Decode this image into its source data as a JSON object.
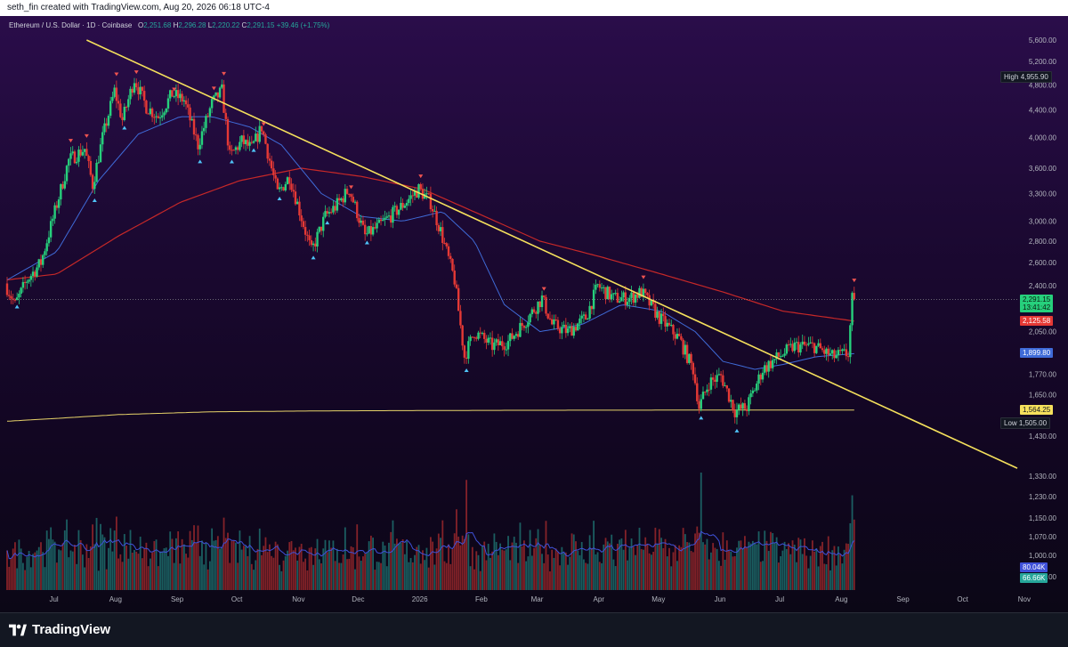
{
  "header": {
    "credit": "seth_fin created with TradingView.com, Aug 20, 2026 06:18 UTC-4"
  },
  "legend": {
    "symbol": "Ethereum / U.S. Dollar · 1D · Coinbase",
    "open_label": "O",
    "open": "2,251.68",
    "high_label": "H",
    "high": "2,296.28",
    "low_label": "L",
    "low": "2,220.22",
    "close_label": "C",
    "close": "2,291.15",
    "change": "+39.46 (+1.75%)"
  },
  "price_tags": {
    "high_label": "High",
    "high_value": "4,955.90",
    "last_value": "2,291.15",
    "countdown": "13:41:42",
    "ma_red": "2,125.58",
    "ma_blue": "1,899.80",
    "ma_yellow": "1,564.25",
    "low_label": "Low",
    "low_value": "1,505.00",
    "vol_blue": "80.04K",
    "vol_green": "66.66K"
  },
  "footer": {
    "brand": "TradingView"
  },
  "colors": {
    "up": "#26d07c",
    "down": "#e53935",
    "ma_blue": "#3f6bd8",
    "ma_red": "#c62828",
    "ma_yellow": "#e8d36a",
    "trendline": "#f5e05c",
    "marker_up": "#4fc3f7",
    "marker_down": "#ef5350"
  },
  "chart_data": {
    "type": "candlestick",
    "price_scale": "log",
    "y_tick_labels": [
      "5,600.00",
      "5,200.00",
      "4,800.00",
      "4,400.00",
      "4,000.00",
      "3,600.00",
      "3,300.00",
      "3,000.00",
      "2,800.00",
      "2,600.00",
      "2,400.00",
      "2,050.00",
      "1,770.00",
      "1,650.00",
      "1,430.00",
      "1,330.00",
      "1,230.00",
      "1,150.00",
      "1,070.00",
      "1,000.00",
      "920.00"
    ],
    "y_ticks": [
      5600,
      5200,
      4800,
      4400,
      4000,
      3600,
      3300,
      3000,
      2800,
      2600,
      2400,
      2050,
      1770,
      1650,
      1430,
      1330,
      1230,
      1150,
      1070,
      1000,
      920
    ],
    "x_labels": [
      "Jul",
      "Aug",
      "Sep",
      "Oct",
      "Nov",
      "Dec",
      "2026",
      "Feb",
      "Mar",
      "Apr",
      "May",
      "Jun",
      "Jul",
      "Aug",
      "Sep",
      "Oct",
      "Nov"
    ],
    "x_label_dates": [
      "2025-07-01",
      "2025-08-01",
      "2025-09-01",
      "2025-10-01",
      "2025-11-01",
      "2025-12-01",
      "2026-01-01",
      "2026-02-01",
      "2026-03-01",
      "2026-04-01",
      "2026-05-01",
      "2026-06-01",
      "2026-07-01",
      "2026-08-01",
      "2026-09-01",
      "2026-10-01",
      "2026-11-01"
    ],
    "price_path": [
      [
        "2025-06-20",
        2420
      ],
      [
        "2025-06-25",
        2250
      ],
      [
        "2025-07-01",
        2450
      ],
      [
        "2025-07-08",
        2600
      ],
      [
        "2025-07-15",
        3100
      ],
      [
        "2025-07-22",
        3700
      ],
      [
        "2025-07-30",
        3850
      ],
      [
        "2025-08-03",
        3400
      ],
      [
        "2025-08-08",
        4000
      ],
      [
        "2025-08-14",
        4700
      ],
      [
        "2025-08-18",
        4250
      ],
      [
        "2025-08-24",
        4900
      ],
      [
        "2025-08-30",
        4450
      ],
      [
        "2025-09-05",
        4300
      ],
      [
        "2025-09-12",
        4650
      ],
      [
        "2025-09-18",
        4550
      ],
      [
        "2025-09-25",
        3900
      ],
      [
        "2025-10-02",
        4500
      ],
      [
        "2025-10-07",
        4700
      ],
      [
        "2025-10-11",
        3750
      ],
      [
        "2025-10-17",
        3950
      ],
      [
        "2025-10-22",
        3850
      ],
      [
        "2025-10-27",
        4150
      ],
      [
        "2025-11-04",
        3300
      ],
      [
        "2025-11-10",
        3500
      ],
      [
        "2025-11-21",
        2700
      ],
      [
        "2025-11-28",
        3050
      ],
      [
        "2025-12-03",
        3150
      ],
      [
        "2025-12-10",
        3350
      ],
      [
        "2025-12-18",
        2850
      ],
      [
        "2025-12-25",
        2950
      ],
      [
        "2026-01-05",
        3150
      ],
      [
        "2026-01-14",
        3350
      ],
      [
        "2026-01-20",
        3200
      ],
      [
        "2026-01-25",
        2900
      ],
      [
        "2026-02-01",
        2450
      ],
      [
        "2026-02-06",
        1880
      ],
      [
        "2026-02-11",
        2050
      ],
      [
        "2026-02-20",
        1950
      ],
      [
        "2026-02-28",
        1980
      ],
      [
        "2026-03-10",
        2150
      ],
      [
        "2026-03-17",
        2300
      ],
      [
        "2026-03-22",
        2100
      ],
      [
        "2026-03-30",
        2050
      ],
      [
        "2026-04-08",
        2150
      ],
      [
        "2026-04-14",
        2400
      ],
      [
        "2026-04-22",
        2300
      ],
      [
        "2026-04-30",
        2300
      ],
      [
        "2026-05-06",
        2350
      ],
      [
        "2026-05-15",
        2150
      ],
      [
        "2026-05-25",
        2000
      ],
      [
        "2026-06-01",
        1800
      ],
      [
        "2026-06-04",
        1580
      ],
      [
        "2026-06-09",
        1720
      ],
      [
        "2026-06-15",
        1760
      ],
      [
        "2026-06-22",
        1560
      ],
      [
        "2026-06-28",
        1580
      ],
      [
        "2026-07-06",
        1800
      ],
      [
        "2026-07-14",
        1880
      ],
      [
        "2026-07-22",
        1950
      ],
      [
        "2026-08-01",
        1950
      ],
      [
        "2026-08-10",
        1880
      ],
      [
        "2026-08-18",
        1900
      ],
      [
        "2026-08-20",
        2290
      ]
    ],
    "ma_blue_path": [
      [
        "2025-06-20",
        2450
      ],
      [
        "2025-07-15",
        2700
      ],
      [
        "2025-08-05",
        3450
      ],
      [
        "2025-08-25",
        4050
      ],
      [
        "2025-09-15",
        4300
      ],
      [
        "2025-10-01",
        4300
      ],
      [
        "2025-10-20",
        4150
      ],
      [
        "2025-11-05",
        3900
      ],
      [
        "2025-11-25",
        3300
      ],
      [
        "2025-12-15",
        3050
      ],
      [
        "2026-01-05",
        3000
      ],
      [
        "2026-01-25",
        3100
      ],
      [
        "2026-02-10",
        2800
      ],
      [
        "2026-02-25",
        2250
      ],
      [
        "2026-03-15",
        2050
      ],
      [
        "2026-04-05",
        2100
      ],
      [
        "2026-04-25",
        2250
      ],
      [
        "2026-05-15",
        2200
      ],
      [
        "2026-06-01",
        2050
      ],
      [
        "2026-06-15",
        1850
      ],
      [
        "2026-07-01",
        1800
      ],
      [
        "2026-07-15",
        1830
      ],
      [
        "2026-08-01",
        1880
      ],
      [
        "2026-08-20",
        1900
      ]
    ],
    "ma_red_path": [
      [
        "2025-06-20",
        2450
      ],
      [
        "2025-07-15",
        2500
      ],
      [
        "2025-08-15",
        2850
      ],
      [
        "2025-09-15",
        3200
      ],
      [
        "2025-10-15",
        3450
      ],
      [
        "2025-11-15",
        3600
      ],
      [
        "2025-12-15",
        3500
      ],
      [
        "2026-01-15",
        3350
      ],
      [
        "2026-02-15",
        3050
      ],
      [
        "2026-03-15",
        2800
      ],
      [
        "2026-04-15",
        2650
      ],
      [
        "2026-05-15",
        2500
      ],
      [
        "2026-06-15",
        2350
      ],
      [
        "2026-07-15",
        2200
      ],
      [
        "2026-08-20",
        2125.58
      ]
    ],
    "ma_yellow_path": [
      [
        "2025-06-20",
        1505
      ],
      [
        "2025-07-15",
        1520
      ],
      [
        "2025-08-15",
        1540
      ],
      [
        "2025-10-01",
        1555
      ],
      [
        "2025-12-01",
        1560
      ],
      [
        "2026-03-01",
        1563
      ],
      [
        "2026-06-01",
        1564
      ],
      [
        "2026-08-20",
        1564.25
      ]
    ],
    "trendline": [
      [
        "2025-07-30",
        5600
      ],
      [
        "2026-11-10",
        1280
      ]
    ],
    "current_price": 2291.15,
    "volume_scale_max": 100,
    "volume_note": "volume histogram, values in thousands"
  }
}
